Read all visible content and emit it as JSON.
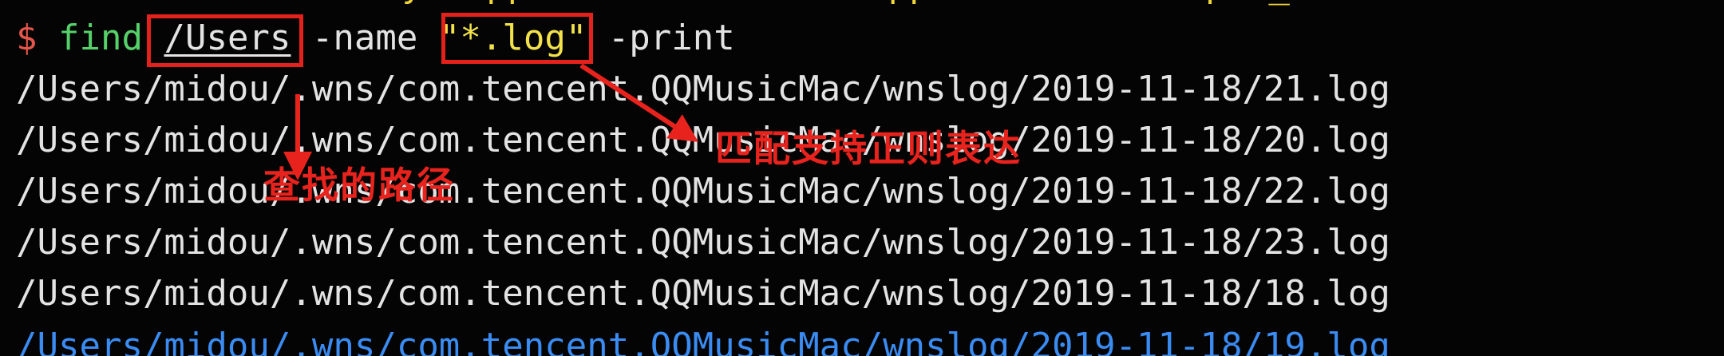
{
  "terminal": {
    "top_partial_text": "                   y   pp                 pp             p  _",
    "command": {
      "prompt": "$",
      "cmd": "find",
      "path": "/Users",
      "flag1": "-name",
      "pattern": "\"*.log\"",
      "flag2": "-print"
    },
    "output_lines": [
      "/Users/midou/.wns/com.tencent.QQMusicMac/wnslog/2019-11-18/21.log",
      "/Users/midou/.wns/com.tencent.QQMusicMac/wnslog/2019-11-18/20.log",
      "/Users/midou/.wns/com.tencent.QQMusicMac/wnslog/2019-11-18/22.log",
      "/Users/midou/.wns/com.tencent.QQMusicMac/wnslog/2019-11-18/23.log",
      "/Users/midou/.wns/com.tencent.QQMusicMac/wnslog/2019-11-18/18.log"
    ],
    "partial_last_line": "/Users/midou/.wns/com.tencent.QQMusicMac/wnslog/2019-11-18/19.log"
  },
  "annotations": {
    "path_label": "查找的路径",
    "pattern_label": "匹配支持正则表达"
  },
  "colors": {
    "background": "#040404",
    "text": "#e3e3e3",
    "prompt": "#e4564b",
    "command": "#56d16a",
    "string": "#f2e24a",
    "annotation": "#e8231d",
    "partial_line": "#3a8cf3"
  }
}
